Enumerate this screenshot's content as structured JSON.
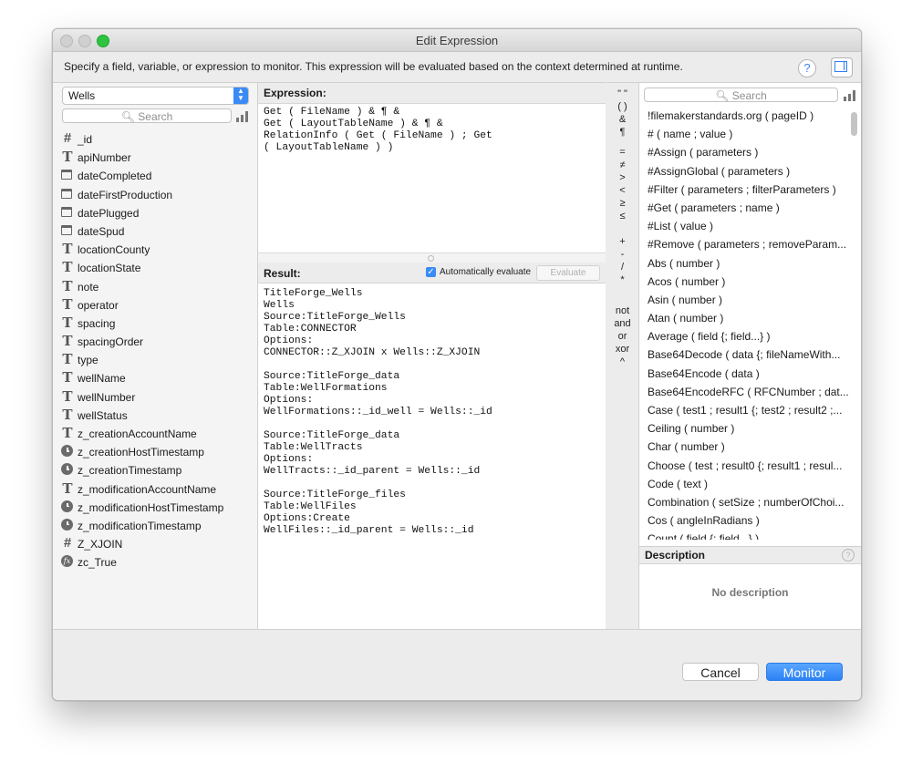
{
  "window": {
    "title": "Edit Expression"
  },
  "instruction": "Specify a field, variable, or expression to monitor. This expression will be evaluated based on the context determined at runtime.",
  "toolbar": {
    "help_label": "?"
  },
  "left": {
    "table_select_value": "Wells",
    "search_placeholder": "Search",
    "fields": [
      {
        "name": "_id",
        "icon": "number-icon"
      },
      {
        "name": "apiNumber",
        "icon": "text-icon"
      },
      {
        "name": "dateCompleted",
        "icon": "date-icon"
      },
      {
        "name": "dateFirstProduction",
        "icon": "date-icon"
      },
      {
        "name": "datePlugged",
        "icon": "date-icon"
      },
      {
        "name": "dateSpud",
        "icon": "date-icon"
      },
      {
        "name": "locationCounty",
        "icon": "text-icon"
      },
      {
        "name": "locationState",
        "icon": "text-icon"
      },
      {
        "name": "note",
        "icon": "text-icon"
      },
      {
        "name": "operator",
        "icon": "text-icon"
      },
      {
        "name": "spacing",
        "icon": "text-icon"
      },
      {
        "name": "spacingOrder",
        "icon": "text-icon"
      },
      {
        "name": "type",
        "icon": "text-icon"
      },
      {
        "name": "wellName",
        "icon": "text-icon"
      },
      {
        "name": "wellNumber",
        "icon": "text-icon"
      },
      {
        "name": "wellStatus",
        "icon": "text-icon"
      },
      {
        "name": "z_creationAccountName",
        "icon": "text-icon"
      },
      {
        "name": "z_creationHostTimestamp",
        "icon": "timestamp-icon"
      },
      {
        "name": "z_creationTimestamp",
        "icon": "timestamp-icon"
      },
      {
        "name": "z_modificationAccountName",
        "icon": "text-icon"
      },
      {
        "name": "z_modificationHostTimestamp",
        "icon": "timestamp-icon"
      },
      {
        "name": "z_modificationTimestamp",
        "icon": "timestamp-icon"
      },
      {
        "name": "Z_XJOIN",
        "icon": "number-icon"
      },
      {
        "name": "zc_True",
        "icon": "calculation-icon"
      }
    ]
  },
  "expression": {
    "header": "Expression:",
    "text": "Get ( FileName ) & ¶ &\nGet ( LayoutTableName ) & ¶ &\nRelationInfo ( Get ( FileName ) ; Get\n( LayoutTableName ) )"
  },
  "result": {
    "header": "Result:",
    "auto_label": "Automatically evaluate",
    "evaluate_label": "Evaluate",
    "text": "TitleForge_Wells\nWells\nSource:TitleForge_Wells\nTable:CONNECTOR\nOptions:\nCONNECTOR::Z_XJOIN x Wells::Z_XJOIN\n\nSource:TitleForge_data\nTable:WellFormations\nOptions:\nWellFormations::_id_well = Wells::_id\n\nSource:TitleForge_data\nTable:WellTracts\nOptions:\nWellTracts::_id_parent = Wells::_id\n\nSource:TitleForge_files\nTable:WellFiles\nOptions:Create\nWellFiles::_id_parent = Wells::_id"
  },
  "operators": [
    "\" \"",
    "( )",
    "&",
    "¶",
    "=",
    "≠",
    ">",
    "<",
    "≥",
    "≤",
    "+",
    "-",
    "/",
    "*",
    "not",
    "and",
    "or",
    "xor",
    "^"
  ],
  "functions": {
    "search_placeholder": "Search",
    "items": [
      "!filemakerstandards.org ( pageID )",
      "# ( name ; value )",
      "#Assign ( parameters )",
      "#AssignGlobal ( parameters )",
      "#Filter ( parameters ; filterParameters )",
      "#Get ( parameters ; name )",
      "#List ( value )",
      "#Remove ( parameters ; removeParam...",
      "Abs ( number )",
      "Acos ( number )",
      "Asin ( number )",
      "Atan ( number )",
      "Average ( field {; field...} )",
      "Base64Decode ( data {; fileNameWith...",
      "Base64Encode ( data )",
      "Base64EncodeRFC ( RFCNumber ; dat...",
      "Case ( test1 ; result1 {; test2 ; result2 ;...",
      "Ceiling ( number )",
      "Char ( number )",
      "Choose ( test ; result0 {; result1 ; resul...",
      "Code ( text )",
      "Combination ( setSize ; numberOfChoi...",
      "Cos ( angleInRadians )",
      "Count ( field {; field...} )"
    ]
  },
  "description": {
    "header": "Description",
    "text": "No description"
  },
  "footer": {
    "cancel_label": "Cancel",
    "monitor_label": "Monitor"
  }
}
